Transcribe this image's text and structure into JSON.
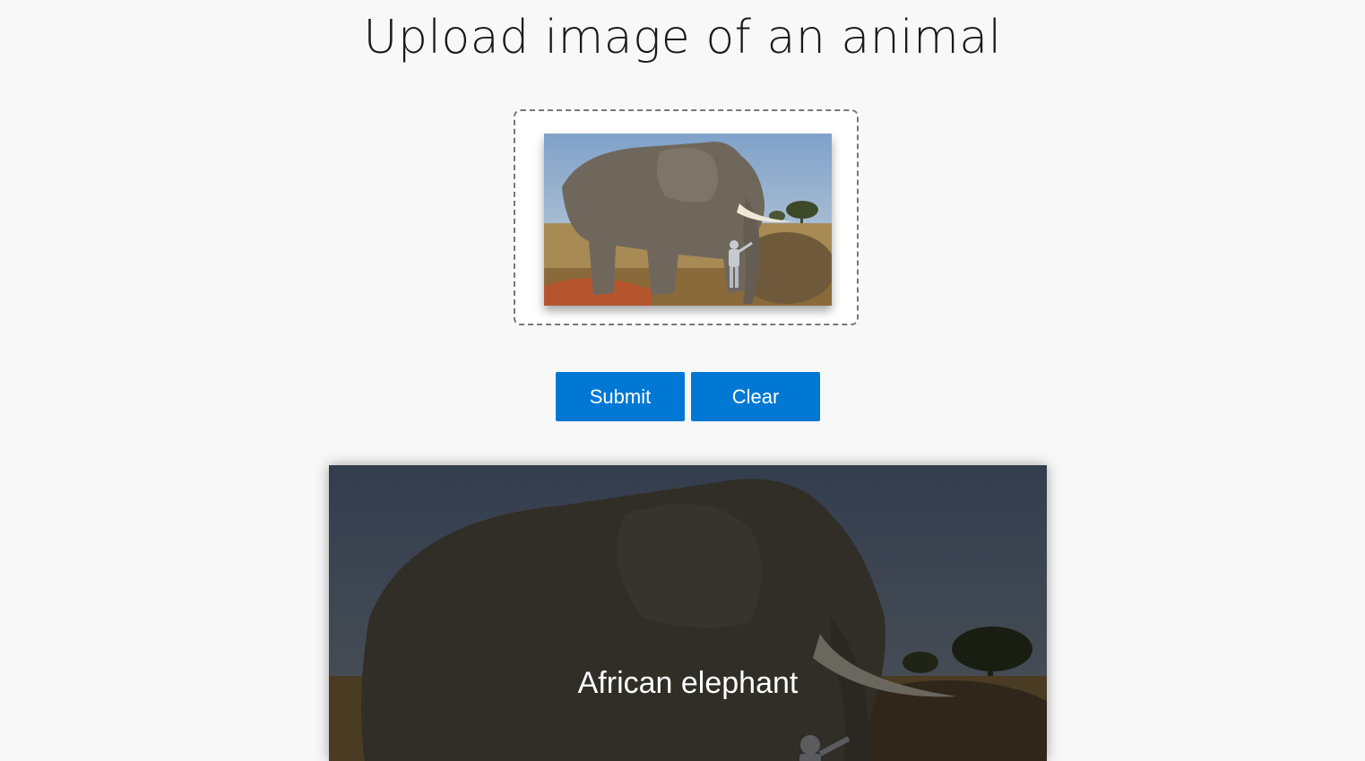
{
  "page": {
    "title": "Upload image of an animal"
  },
  "upload": {
    "preview_image": "elephant-photo"
  },
  "buttons": {
    "submit_label": "Submit",
    "clear_label": "Clear"
  },
  "result": {
    "label": "African elephant",
    "image": "elephant-photo"
  },
  "colors": {
    "accent": "#0078d4",
    "background": "#f8f8f8"
  }
}
